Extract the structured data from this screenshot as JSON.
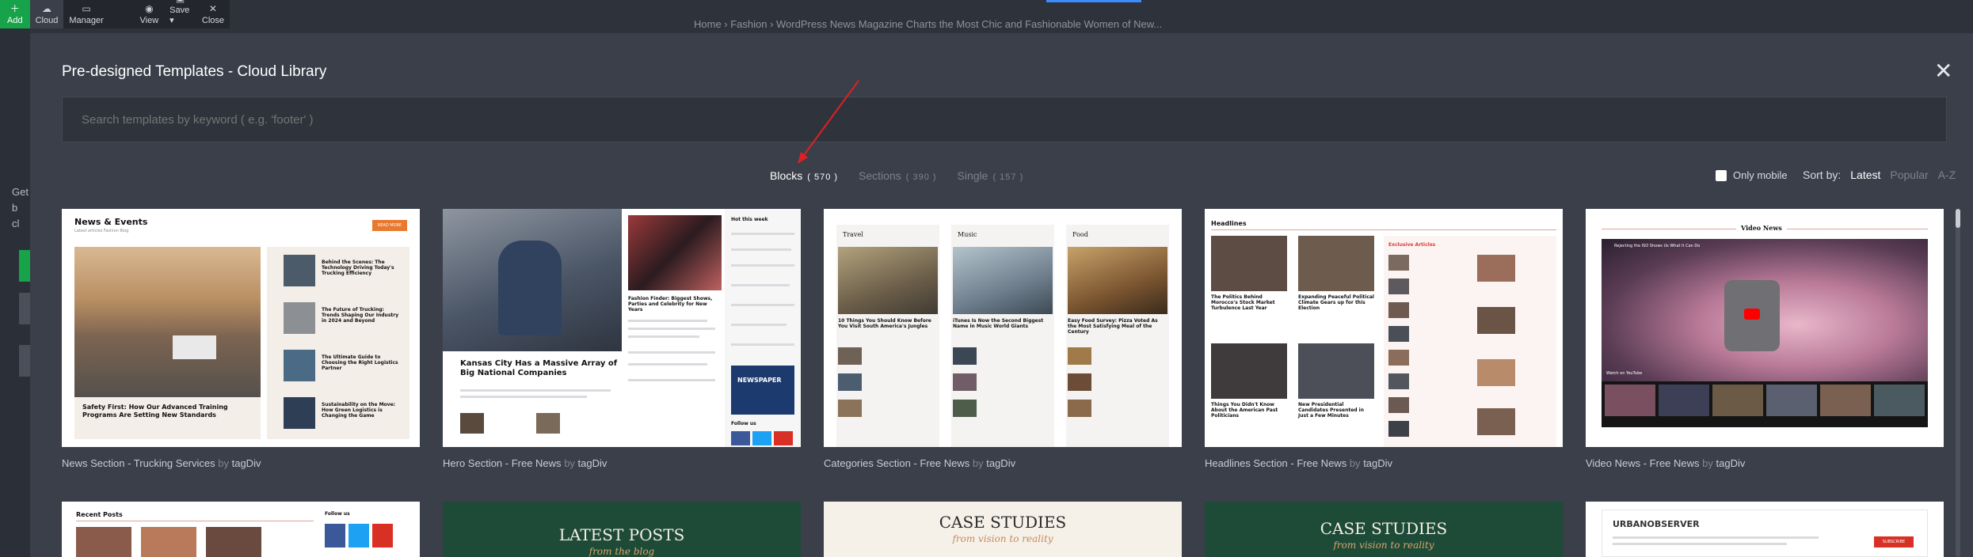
{
  "toolbar": {
    "items": [
      {
        "label": "Add",
        "icon": "plus-icon"
      },
      {
        "label": "Cloud",
        "icon": "cloud-icon"
      },
      {
        "label": "Manager",
        "icon": "manager-icon"
      },
      {
        "label": "View",
        "icon": "eye-icon"
      },
      {
        "label": "Save",
        "icon": "save-icon"
      },
      {
        "label": "Close",
        "icon": "close-icon"
      }
    ]
  },
  "breadcrumb": "Home › Fashion › WordPress News Magazine Charts the Most Chic and Fashionable Women of New...",
  "modal": {
    "title": "Pre-designed Templates - Cloud Library",
    "search_placeholder": "Search templates by keyword ( e.g. 'footer' )",
    "tabs": [
      {
        "label": "Blocks",
        "count": "( 570 )",
        "active": true
      },
      {
        "label": "Sections",
        "count": "( 390 )",
        "active": false
      },
      {
        "label": "Single",
        "count": "( 157 )",
        "active": false
      }
    ],
    "only_mobile_label": "Only mobile",
    "sort_label": "Sort by:",
    "sort_options": [
      "Latest",
      "Popular",
      "A-Z"
    ],
    "templates": [
      {
        "name": "News Section - Trucking Services",
        "by": "by",
        "author": "tagDiv"
      },
      {
        "name": "Hero Section - Free News",
        "by": "by",
        "author": "tagDiv"
      },
      {
        "name": "Categories Section - Free News",
        "by": "by",
        "author": "tagDiv"
      },
      {
        "name": "Headlines Section - Free News",
        "by": "by",
        "author": "tagDiv"
      },
      {
        "name": "Video News - Free News",
        "by": "by",
        "author": "tagDiv"
      }
    ]
  },
  "thumbs": {
    "t1": {
      "heading": "News & Events",
      "sub": "Latest articles Fashion Blog",
      "btn": "READ MORE",
      "main": "Safety First: How Our Advanced Training Programs Are Setting New Standards",
      "side": [
        "Behind the Scenes: The Technology Driving Today's Trucking Efficiency",
        "The Future of Trucking: Trends Shaping Our Industry in 2024 and Beyond",
        "The Ultimate Guide to Choosing the Right Logistics Partner",
        "Sustainability on the Move: How Green Logistics is Changing the Game"
      ]
    },
    "t2": {
      "main": "Kansas City Has a Massive Array of Big National Companies",
      "mid": "Fashion Finder: Biggest Shows, Parties and Celebrity for New Years",
      "side_head": "Hot this week",
      "newsletter": "NEWSPAPER",
      "follow": "Follow us"
    },
    "t3": {
      "cats": [
        "Travel",
        "Music",
        "Food"
      ],
      "heads": [
        "10 Things You Should Know Before You Visit South America's Jungles",
        "iTunes Is Now the Second Biggest Name in Music World Giants",
        "Easy Food Survey: Pizza Voted As the Most Satisfying Meal of the Century"
      ]
    },
    "t4": {
      "heading": "Headlines",
      "excl": "Exclusive Articles",
      "heads": [
        "The Politics Behind Morocco's Stock Market Turbulence Last Year",
        "Expanding Peaceful Political Climate Gears up for this Election",
        "Things You Didn't Know About the American Past Politicians",
        "New Presidential Candidates Presented in Just a Few Minutes"
      ]
    },
    "t5": {
      "heading": "Video News",
      "video_title": "Rejecting the ISO Shows Us What It Can Do",
      "watch": "Watch on",
      "yt": "YouTube"
    },
    "row2": [
      "Recent Posts",
      "LATEST POSTS",
      "from the blog",
      "CASE STUDIES",
      "from vision to reality",
      "CASE STUDIES",
      "from vision to reality",
      "URBANOBSERVER",
      "Follow us",
      "SUBSCRIBE"
    ]
  }
}
